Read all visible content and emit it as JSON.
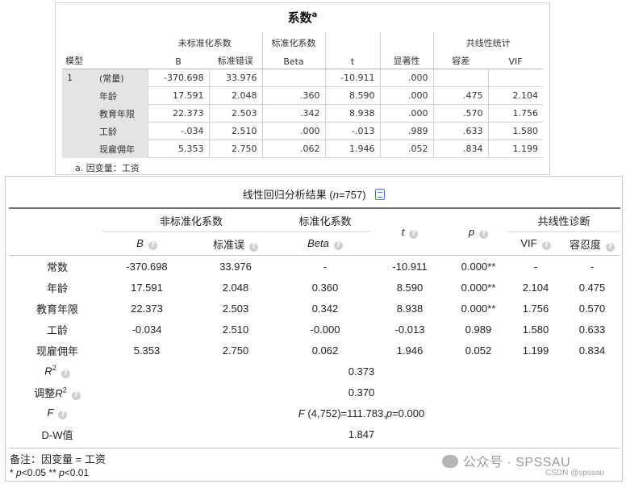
{
  "spss": {
    "title": "系数",
    "title_sup": "a",
    "group_headers": {
      "unstd": "未标准化系数",
      "std": "标准化系数",
      "colin": "共线性统计"
    },
    "sub_headers": {
      "model": "模型",
      "b": "B",
      "se": "标准错误",
      "beta": "Beta",
      "t": "t",
      "sig": "显著性",
      "tol": "容差",
      "vif": "VIF"
    },
    "model_no": "1",
    "rows": [
      {
        "label": "(常量)",
        "b": "-370.698",
        "se": "33.976",
        "beta": "",
        "t": "-10.911",
        "sig": ".000",
        "tol": "",
        "vif": ""
      },
      {
        "label": "年龄",
        "b": "17.591",
        "se": "2.048",
        "beta": ".360",
        "t": "8.590",
        "sig": ".000",
        "tol": ".475",
        "vif": "2.104"
      },
      {
        "label": "教育年限",
        "b": "22.373",
        "se": "2.503",
        "beta": ".342",
        "t": "8.938",
        "sig": ".000",
        "tol": ".570",
        "vif": "1.756"
      },
      {
        "label": "工龄",
        "b": "-.034",
        "se": "2.510",
        "beta": ".000",
        "t": "-.013",
        "sig": ".989",
        "tol": ".633",
        "vif": "1.580"
      },
      {
        "label": "现雇佣年",
        "b": "5.353",
        "se": "2.750",
        "beta": ".062",
        "t": "1.946",
        "sig": ".052",
        "tol": ".834",
        "vif": "1.199"
      }
    ],
    "footnote": "a. 因变量：工资"
  },
  "results": {
    "title_prefix": "线性回归分析结果 (",
    "title_n": "n",
    "title_suffix": "=757)",
    "group_headers": {
      "unstd": "非标准化系数",
      "std": "标准化系数",
      "t": "t",
      "p": "p",
      "colin": "共线性诊断"
    },
    "sub_headers": {
      "b": "B",
      "se": "标准误",
      "beta": "Beta",
      "vif": "VIF",
      "tol": "容忍度"
    },
    "help_glyph": "?",
    "rows": [
      {
        "label": "常数",
        "b": "-370.698",
        "se": "33.976",
        "beta": "-",
        "t": "-10.911",
        "p": "0.000**",
        "vif": "-",
        "tol": "-"
      },
      {
        "label": "年龄",
        "b": "17.591",
        "se": "2.048",
        "beta": "0.360",
        "t": "8.590",
        "p": "0.000**",
        "vif": "2.104",
        "tol": "0.475"
      },
      {
        "label": "教育年限",
        "b": "22.373",
        "se": "2.503",
        "beta": "0.342",
        "t": "8.938",
        "p": "0.000**",
        "vif": "1.756",
        "tol": "0.570"
      },
      {
        "label": "工龄",
        "b": "-0.034",
        "se": "2.510",
        "beta": "-0.000",
        "t": "-0.013",
        "p": "0.989",
        "vif": "1.580",
        "tol": "0.633"
      },
      {
        "label": "现雇佣年",
        "b": "5.353",
        "se": "2.750",
        "beta": "0.062",
        "t": "1.946",
        "p": "0.052",
        "vif": "1.199",
        "tol": "0.834"
      }
    ],
    "summary": {
      "r2_label_r": "R",
      "r2_label_sup": "2",
      "r2_value": "0.373",
      "adj_r2_prefix": "调整",
      "adj_r2_r": "R",
      "adj_r2_sup": "2",
      "adj_r2_value": "0.370",
      "f_label": "F",
      "f_value_f": "F",
      "f_value_rest1": " (4,752)=111.783,",
      "f_value_p": "p",
      "f_value_rest2": "=0.000",
      "dw_label": "D-W值",
      "dw_value": "1.847"
    },
    "note": "备注：因变量 = 工资",
    "sig_p1": "p",
    "sig_mid": "<0.05 ** ",
    "sig_p2": "p",
    "sig_end": "<0.01",
    "sig_star": "* "
  },
  "watermark": {
    "main": "公众号 · SPSSAU",
    "sub": "CSDN @spssau"
  },
  "colors": {
    "icon_blue": "#3a7bd5",
    "label_bg": "#e4e4e4"
  }
}
